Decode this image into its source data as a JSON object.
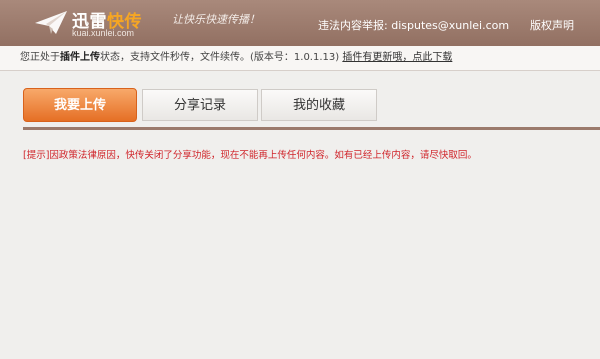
{
  "header": {
    "logo_text_main": "迅雷",
    "logo_text_accent": "快传",
    "logo_domain": "kuai.xunlei.com",
    "slogan": "让快乐快速传播！",
    "report_label": "违法内容举报:",
    "report_email": "disputes@xunlei.com",
    "copyright": "版权声明"
  },
  "infobar": {
    "text_before": "您正处于",
    "status_strong": "插件上传",
    "text_after": "状态，支持文件秒传，文件续传。(版本号：1.0.1.13)",
    "update_link": "插件有更新哦，点此下载"
  },
  "tabs": [
    {
      "label": "我要上传",
      "active": true
    },
    {
      "label": "分享记录",
      "active": false
    },
    {
      "label": "我的收藏",
      "active": false
    }
  ],
  "notice": "[提示]因政策法律原因，快传关闭了分享功能，现在不能再上传任何内容。如有已经上传内容，请尽快取回。",
  "colors": {
    "header_bg": "#9e7f71",
    "accent": "#f6a623",
    "tab_active": "#e97a30",
    "notice": "#d0242a",
    "divider": "#9b7a6c"
  },
  "icons": {
    "logo": "paper-plane-icon"
  }
}
